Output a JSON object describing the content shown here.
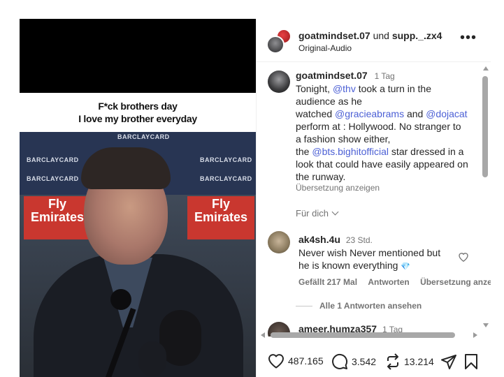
{
  "media": {
    "caption_line1": "F*ck brothers day",
    "caption_line2": "I love my brother everyday",
    "banner_text": "BARCLAYCARD",
    "fly_label": "Fly",
    "emirates_label": "Emirates"
  },
  "header": {
    "username": "goatmindset.07",
    "connector": "und",
    "collaborator": "supp._.zx4",
    "audio": "Original-Audio",
    "more_label": "•••"
  },
  "post": {
    "username": "goatmindset.07",
    "time": "1 Tag",
    "lines": [
      [
        "Tonight, ",
        "@thv",
        " took a turn in the"
      ],
      [
        "audience as he",
        "",
        ""
      ],
      [
        "watched ",
        "@gracieabrams",
        " and "
      ],
      [
        "perform at : Hollywood. No stranger to",
        "",
        ""
      ],
      [
        "a fashion show either,",
        "",
        ""
      ],
      [
        "the ",
        "@bts.bighitofficial",
        " star dressed in a"
      ],
      [
        "look that could have easily appeared on",
        "",
        ""
      ],
      [
        "the runway.",
        "",
        ""
      ]
    ],
    "mention_dojacat": "@dojacat",
    "translate": "Übersetzung anzeigen",
    "for_you": "Für dich"
  },
  "comments": [
    {
      "username": "ak4sh.4u",
      "time": "23 Std.",
      "line1": "Never wish Never mentioned but",
      "line2": "he is known everything",
      "emoji": "💎",
      "likes": "Gefällt 217 Mal",
      "reply": "Antworten",
      "translate": "Übersetzung anze",
      "view_replies": "Alle 1 Antworten ansehen"
    },
    {
      "username": "ameer.humza357",
      "time": "1 Tag"
    }
  ],
  "actions": {
    "likes": "487.165",
    "comments": "3.542",
    "reposts": "13.214"
  }
}
